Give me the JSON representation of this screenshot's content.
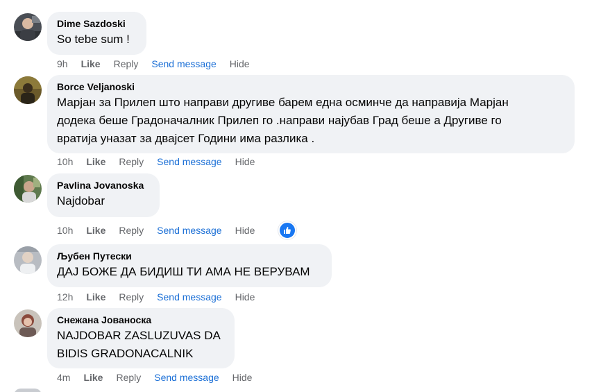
{
  "top_partial": "",
  "comments": [
    {
      "author": "Dime Sazdoski",
      "text": "So tebe sum !",
      "time": "9h",
      "like": "Like",
      "reply": "Reply",
      "send": "Send message",
      "hide": "Hide"
    },
    {
      "author": "Borce Veljanoski",
      "text_lines": [
        "Марјан за Прилеп што направи другиве барем една осминче да направија Марјан",
        "додека беше Градоначалник Прилеп го .направи најубав Град беше а Другиве го",
        "вратија уназат за двајсет Години има разлика ."
      ],
      "time": "10h",
      "like": "Like",
      "reply": "Reply",
      "send": "Send message",
      "hide": "Hide"
    },
    {
      "author": "Pavlina Jovanoska",
      "text": "Najdobar",
      "time": "10h",
      "like": "Like",
      "reply": "Reply",
      "send": "Send message",
      "hide": "Hide",
      "reaction_icon": "thumbs-up-icon"
    },
    {
      "author": "Љубен Путески",
      "text": "ДАЈ БОЖЕ ДА БИДИШ ТИ АМА НЕ ВЕРУВАМ",
      "time": "12h",
      "like": "Like",
      "reply": "Reply",
      "send": "Send message",
      "hide": "Hide"
    },
    {
      "author": "Снежана Јованоска",
      "text_lines": [
        "NAJDOBAR ZASLUZUVAS DA",
        "BIDIS GRADONACALNIK"
      ],
      "time": "4m",
      "like": "Like",
      "reply": "Reply",
      "send": "Send message",
      "hide": "Hide"
    }
  ],
  "colors": {
    "bubble_bg": "#f0f2f5",
    "meta_text": "#65676b",
    "send_link": "#1b6fd6",
    "reaction_blue": "#1877f2"
  }
}
